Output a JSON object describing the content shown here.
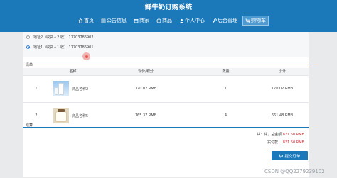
{
  "header": {
    "site_title": "鲜牛奶订购系统",
    "nav": [
      {
        "icon": "home-icon",
        "label": "首页"
      },
      {
        "icon": "notice-icon",
        "label": "公告信息"
      },
      {
        "icon": "shop-icon",
        "label": "商家"
      },
      {
        "icon": "goods-icon",
        "label": "商品"
      },
      {
        "icon": "user-icon",
        "label": "个人中心"
      },
      {
        "icon": "wrench-icon",
        "label": "后台管理"
      },
      {
        "icon": "cart-icon",
        "label": "购物车",
        "active": true
      }
    ]
  },
  "addresses": [
    {
      "text": "地址2（收货人2 收） 17703786902",
      "selected": false
    },
    {
      "text": "地址1（收货人1 收） 17703786901",
      "selected": true
    }
  ],
  "cart": {
    "section_label": "清单",
    "columns": [
      "",
      "名称",
      "现价/积分",
      "数量",
      "小计"
    ],
    "rows": [
      {
        "index": "1",
        "name": "商品名称2",
        "price": "170.02 RMB",
        "qty": "1",
        "subtotal": "170.02 RMB"
      },
      {
        "index": "2",
        "name": "商品名称5",
        "price": "165.37 RMB",
        "qty": "4",
        "subtotal": "661.48 RMB"
      }
    ]
  },
  "checkout": {
    "section_label": "结算",
    "total_line": "共：件，总金额",
    "total_amount": "831.50 RMB",
    "paid_label": "实付款：",
    "paid_amount": "831.50 RMB",
    "submit_label": "提交订单"
  },
  "watermark": "CSDN @QQ2279239102"
}
